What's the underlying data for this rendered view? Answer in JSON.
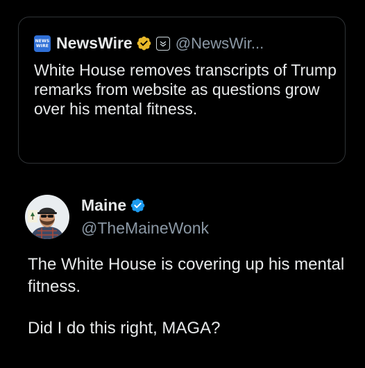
{
  "quoted_post": {
    "logo_text": [
      "NEWS",
      "WIRE"
    ],
    "author_name": "NewsWire",
    "author_handle": "@NewsWir...",
    "verified_badge": "gold-check-icon",
    "affiliate_badge": "newspaper-icon",
    "text": "White House removes transcripts of Trump remarks from website as questions grow over his mental fitness."
  },
  "post": {
    "avatar": "profile-photo-avatar",
    "author_name": "Maine",
    "author_handle": "@TheMaineWonk",
    "verified_badge": "blue-check-icon",
    "text_paragraph_1": "The White House is covering up his mental fitness.",
    "text_paragraph_2": "Did I do this right, MAGA?"
  },
  "colors": {
    "background": "#000000",
    "primary_text": "#e7e9ea",
    "secondary_text": "#8b98a5",
    "border": "#2f3336",
    "gold_badge": "#e8b829",
    "blue_badge": "#1d9bf0",
    "logo_blue": "#2f6fd6"
  }
}
